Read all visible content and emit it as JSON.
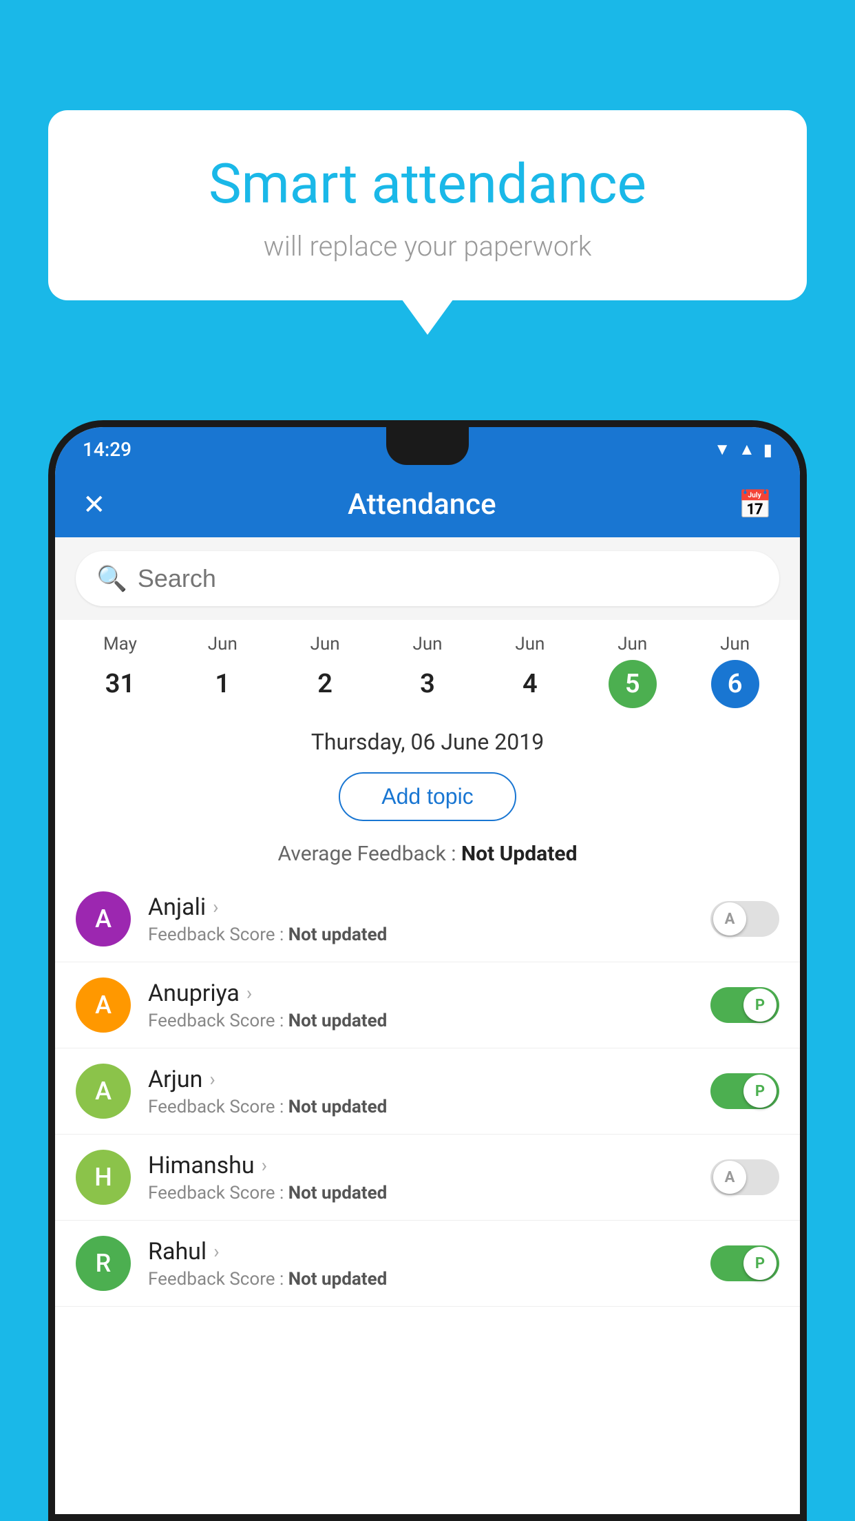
{
  "background_color": "#1ab8e8",
  "speech_bubble": {
    "headline": "Smart attendance",
    "subtext": "will replace your paperwork"
  },
  "status_bar": {
    "time": "14:29",
    "icons": [
      "wifi",
      "signal",
      "battery"
    ]
  },
  "app_bar": {
    "title": "Attendance",
    "close_icon": "✕",
    "calendar_icon": "📅"
  },
  "search": {
    "placeholder": "Search"
  },
  "calendar": {
    "days": [
      {
        "month": "May",
        "date": "31",
        "state": "normal"
      },
      {
        "month": "Jun",
        "date": "1",
        "state": "normal"
      },
      {
        "month": "Jun",
        "date": "2",
        "state": "normal"
      },
      {
        "month": "Jun",
        "date": "3",
        "state": "normal"
      },
      {
        "month": "Jun",
        "date": "4",
        "state": "normal"
      },
      {
        "month": "Jun",
        "date": "5",
        "state": "today"
      },
      {
        "month": "Jun",
        "date": "6",
        "state": "selected"
      }
    ]
  },
  "selected_date": "Thursday, 06 June 2019",
  "add_topic_label": "Add topic",
  "average_feedback": {
    "label": "Average Feedback : ",
    "value": "Not Updated"
  },
  "students": [
    {
      "name": "Anjali",
      "avatar_letter": "A",
      "avatar_color": "#9c27b0",
      "feedback": "Feedback Score : Not updated",
      "toggle_state": "off",
      "toggle_label": "A"
    },
    {
      "name": "Anupriya",
      "avatar_letter": "A",
      "avatar_color": "#ff9800",
      "feedback": "Feedback Score : Not updated",
      "toggle_state": "on",
      "toggle_label": "P"
    },
    {
      "name": "Arjun",
      "avatar_letter": "A",
      "avatar_color": "#8bc34a",
      "feedback": "Feedback Score : Not updated",
      "toggle_state": "on",
      "toggle_label": "P"
    },
    {
      "name": "Himanshu",
      "avatar_letter": "H",
      "avatar_color": "#8bc34a",
      "feedback": "Feedback Score : Not updated",
      "toggle_state": "off",
      "toggle_label": "A"
    },
    {
      "name": "Rahul",
      "avatar_letter": "R",
      "avatar_color": "#4caf50",
      "feedback": "Feedback Score : Not updated",
      "toggle_state": "on",
      "toggle_label": "P"
    }
  ]
}
